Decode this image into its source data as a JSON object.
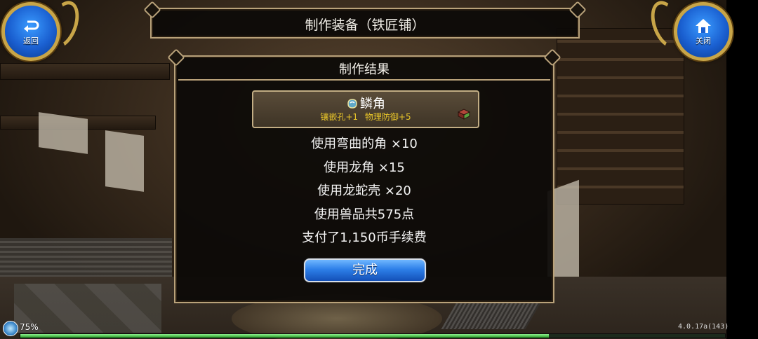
{
  "top": {
    "back_label": "返回",
    "close_label": "关闭",
    "title": "制作装备（铁匠铺）"
  },
  "panel": {
    "title": "制作结果",
    "item": {
      "name": "鳞角",
      "stats": [
        "镶嵌孔+1",
        "物理防御+5"
      ],
      "stat_color": "#e8c52a"
    },
    "lines": [
      "使用弯曲的角 ×10",
      "使用龙角 ×15",
      "使用龙蛇壳 ×20",
      "使用兽品共575点",
      "支付了1,150币手续费"
    ],
    "done_label": "完成"
  },
  "hud": {
    "percent": "75%",
    "progress": 0.75,
    "version": "4.0.17a(143)"
  },
  "colors": {
    "frame": "#b9a27a",
    "button_blue": "#2d7fe8",
    "gold": "#c8a548"
  },
  "icons": [
    "back-arrow-icon",
    "home-icon",
    "gem-icon",
    "book-icon",
    "orb-icon"
  ]
}
